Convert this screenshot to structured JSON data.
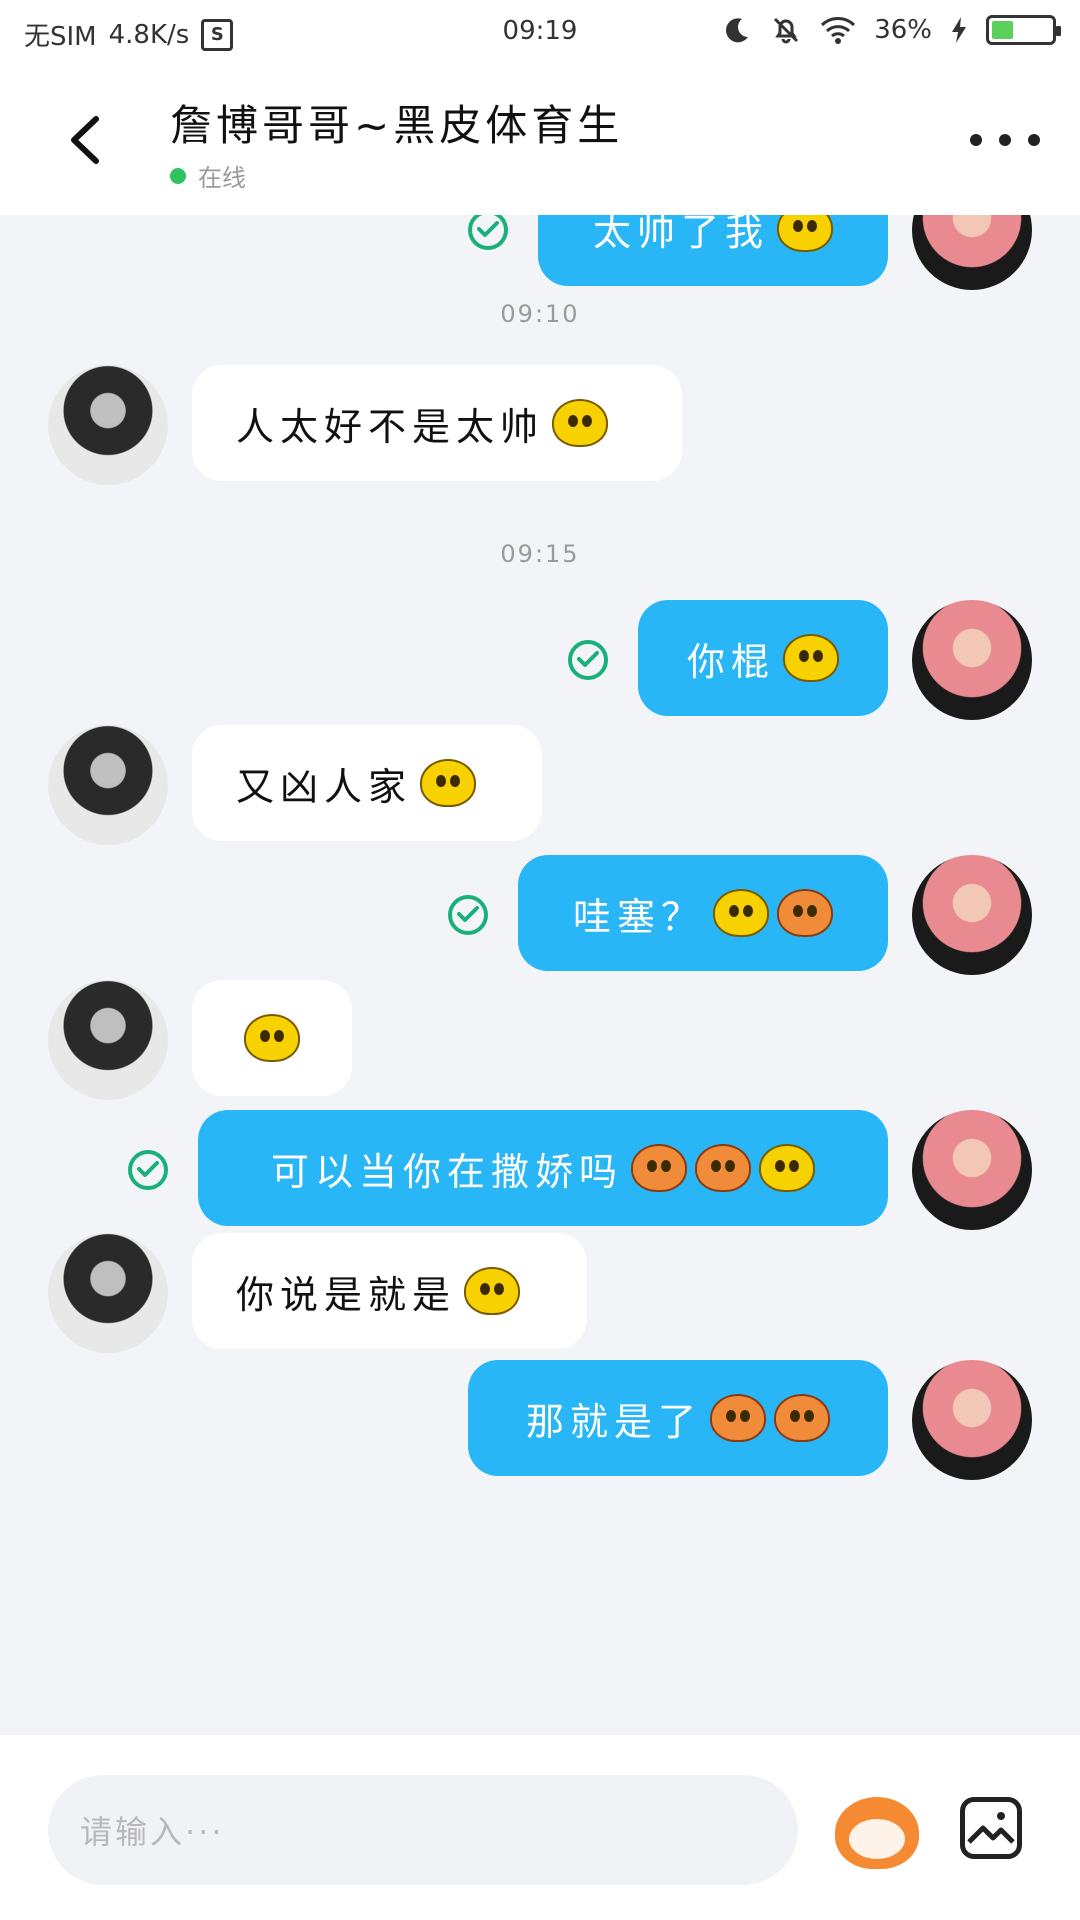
{
  "status_bar": {
    "carrier": "无SIM",
    "speed": "4.8K/s",
    "s_badge": "S",
    "time": "09:19",
    "battery": "36%",
    "battery_level": 0.36,
    "icons": [
      "moon-icon",
      "bell-off-icon",
      "wifi-icon",
      "charging-icon",
      "battery-icon"
    ]
  },
  "header": {
    "title": "詹博哥哥~黑皮体育生",
    "status": "在线",
    "back_icon": "chevron-left-icon",
    "more_icon": "more-dots-icon"
  },
  "chat": {
    "messages": [
      {
        "type": "message",
        "side": "me",
        "text": "太帅了我",
        "emojis": [
          "yellow"
        ],
        "read": true
      },
      {
        "type": "timestamp",
        "text": "09:10"
      },
      {
        "type": "message",
        "side": "other",
        "text": "人太好不是太帅",
        "emojis": [
          "yellow"
        ]
      },
      {
        "type": "timestamp",
        "text": "09:15"
      },
      {
        "type": "message",
        "side": "me",
        "text": "你棍",
        "emojis": [
          "yellow"
        ],
        "read": true
      },
      {
        "type": "message",
        "side": "other",
        "text": "又凶人家",
        "emojis": [
          "yellow"
        ]
      },
      {
        "type": "message",
        "side": "me",
        "text": "哇塞？",
        "emojis": [
          "yellow",
          "orange"
        ],
        "read": true
      },
      {
        "type": "message",
        "side": "other",
        "text": "",
        "emojis": [
          "yellow"
        ]
      },
      {
        "type": "message",
        "side": "me",
        "text": "可以当你在撒娇吗",
        "emojis": [
          "orange",
          "orange",
          "yellow"
        ],
        "read": true
      },
      {
        "type": "message",
        "side": "other",
        "text": "你说是就是",
        "emojis": [
          "yellow"
        ]
      },
      {
        "type": "message",
        "side": "me",
        "text": "那就是了",
        "emojis": [
          "orange",
          "orange"
        ],
        "read": false
      }
    ]
  },
  "input": {
    "placeholder": "请输入···",
    "emoji_icon": "sticker-icon",
    "image_icon": "image-icon"
  },
  "colors": {
    "accent": "#29b6f6",
    "online": "#2fc35f",
    "check": "#19b07a",
    "background": "#f3f4f8"
  }
}
